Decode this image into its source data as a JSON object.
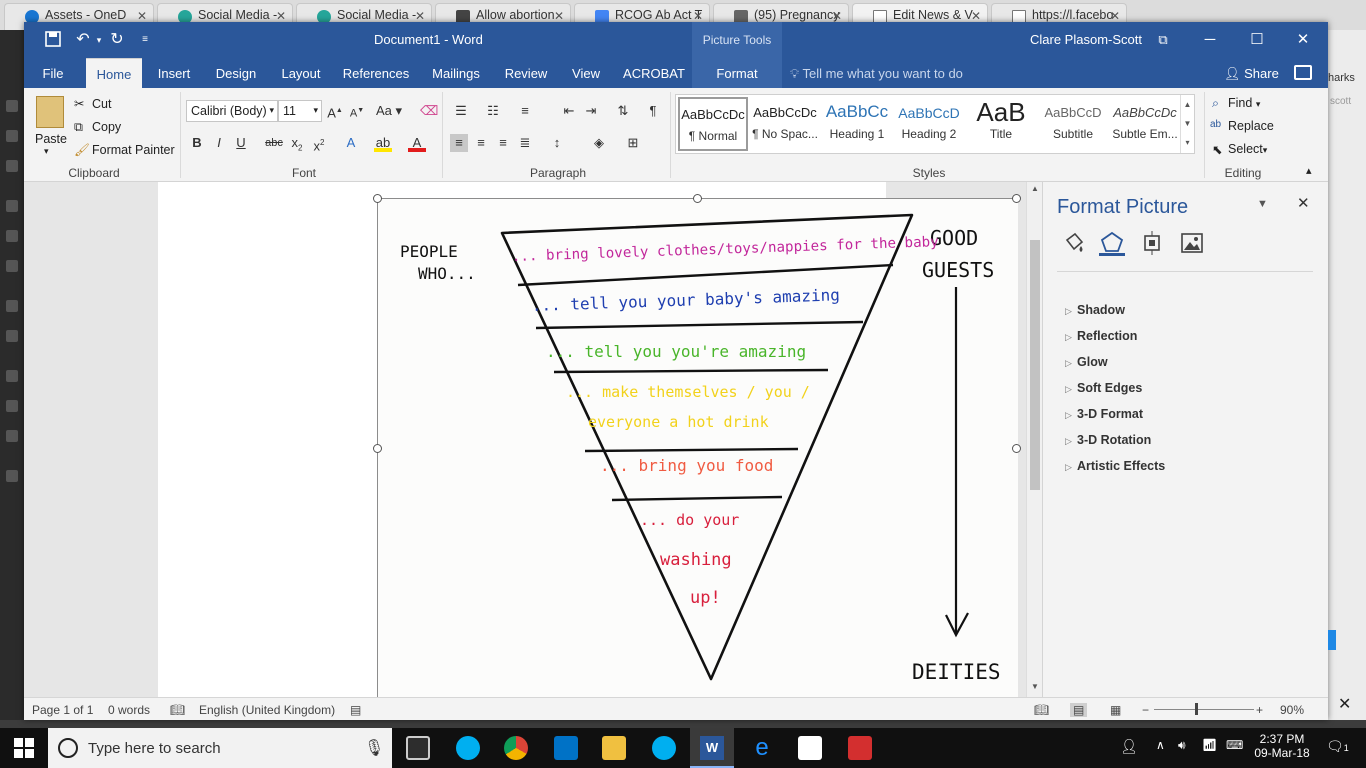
{
  "browser": {
    "tabs": [
      {
        "label": "Assets - OneD",
        "color": "#1976d2"
      },
      {
        "label": "Social Media -",
        "color": "#26a69a"
      },
      {
        "label": "Social Media -",
        "color": "#26a69a"
      },
      {
        "label": "Allow abortion",
        "color": "#444444"
      },
      {
        "label": "RCOG Ab Act T",
        "color": "#4285f4"
      },
      {
        "label": "(95) Pregnancy",
        "color": "#666666"
      },
      {
        "label": "Edit News & V",
        "color": "#777777"
      },
      {
        "label": "https://l.facebo",
        "color": "#777777"
      }
    ],
    "side_text_right": "harks",
    "side_text_right2": "scott"
  },
  "word": {
    "doc_title": "Document1 - Word",
    "picture_tools": "Picture Tools",
    "user_name": "Clare Plasom-Scott",
    "tabs": [
      "File",
      "Home",
      "Insert",
      "Design",
      "Layout",
      "References",
      "Mailings",
      "Review",
      "View",
      "ACROBAT",
      "Format"
    ],
    "tell_me": "Tell me what you want to do",
    "share": "Share",
    "clipboard": {
      "paste": "Paste",
      "cut": "Cut",
      "copy": "Copy",
      "format_painter": "Format Painter",
      "label": "Clipboard"
    },
    "font": {
      "name": "Calibri (Body)",
      "size": "11",
      "label": "Font",
      "case": "Aa"
    },
    "paragraph": {
      "label": "Paragraph"
    },
    "styles": {
      "label": "Styles",
      "items": [
        {
          "preview": "AaBbCcDc",
          "name": "¶ Normal"
        },
        {
          "preview": "AaBbCcDc",
          "name": "¶ No Spac..."
        },
        {
          "preview": "AaBbCc",
          "name": "Heading 1"
        },
        {
          "preview": "AaBbCcD",
          "name": "Heading 2"
        },
        {
          "preview": "AaB",
          "name": "Title"
        },
        {
          "preview": "AaBbCcD",
          "name": "Subtitle"
        },
        {
          "preview": "AaBbCcDc",
          "name": "Subtle Em..."
        }
      ]
    },
    "editing": {
      "find": "Find",
      "replace": "Replace",
      "select": "Select",
      "label": "Editing"
    },
    "image": {
      "left_label": [
        "PEOPLE",
        "WHO..."
      ],
      "right_top": [
        "GOOD",
        "GUESTS"
      ],
      "right_bottom": "DEITIES",
      "lines": [
        {
          "text": "... bring lovely clothes/toys/nappies for the baby",
          "color": "#c2279b"
        },
        {
          "text": "... tell you your baby's amazing",
          "color": "#1f3fb0"
        },
        {
          "text": "... tell you you're amazing",
          "color": "#49b52a"
        },
        {
          "text": "... make themselves / you /",
          "color": "#f2d21c"
        },
        {
          "text": "everyone a hot drink",
          "color": "#f2d21c"
        },
        {
          "text": "... bring you food",
          "color": "#f05b42"
        },
        {
          "text": "... do your",
          "color": "#d81f3c"
        },
        {
          "text": "washing",
          "color": "#d81f3c"
        },
        {
          "text": "up!",
          "color": "#d81f3c"
        }
      ]
    },
    "pane": {
      "title": "Format Picture",
      "items": [
        "Shadow",
        "Reflection",
        "Glow",
        "Soft Edges",
        "3-D Format",
        "3-D Rotation",
        "Artistic Effects"
      ]
    },
    "status": {
      "page": "Page 1 of 1",
      "words": "0 words",
      "language": "English (United Kingdom)",
      "zoom": "90%"
    }
  },
  "taskbar": {
    "search_placeholder": "Type here to search",
    "time": "2:37 PM",
    "date": "09-Mar-18",
    "notifications": "1"
  }
}
